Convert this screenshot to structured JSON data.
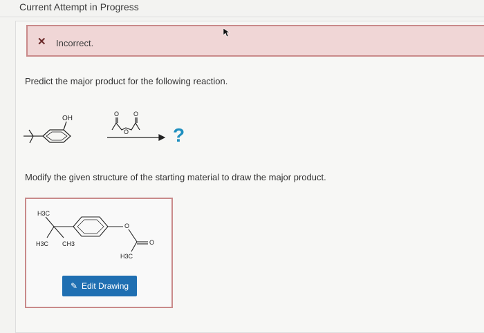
{
  "header": {
    "title": "Current Attempt in Progress"
  },
  "alert": {
    "icon": "x-icon",
    "message": "Incorrect."
  },
  "question": {
    "prompt": "Predict the major product for the following reaction."
  },
  "reaction": {
    "reactant_label": "OH",
    "result_mark": "?",
    "reagent_atoms": [
      "O",
      "O",
      "O"
    ]
  },
  "instructions": {
    "text": "Modify the given structure of the starting material to draw the major product."
  },
  "drawing": {
    "labels": [
      "H3C",
      "H3C",
      "CH3",
      "O",
      "H3C",
      "O"
    ],
    "edit_button_label": "Edit Drawing",
    "edit_icon": "pencil-icon"
  },
  "colors": {
    "alert_bg": "#f0d6d6",
    "alert_border": "#c98a8a",
    "button_bg": "#1f6fb2",
    "question_mark": "#1f8fbf"
  }
}
